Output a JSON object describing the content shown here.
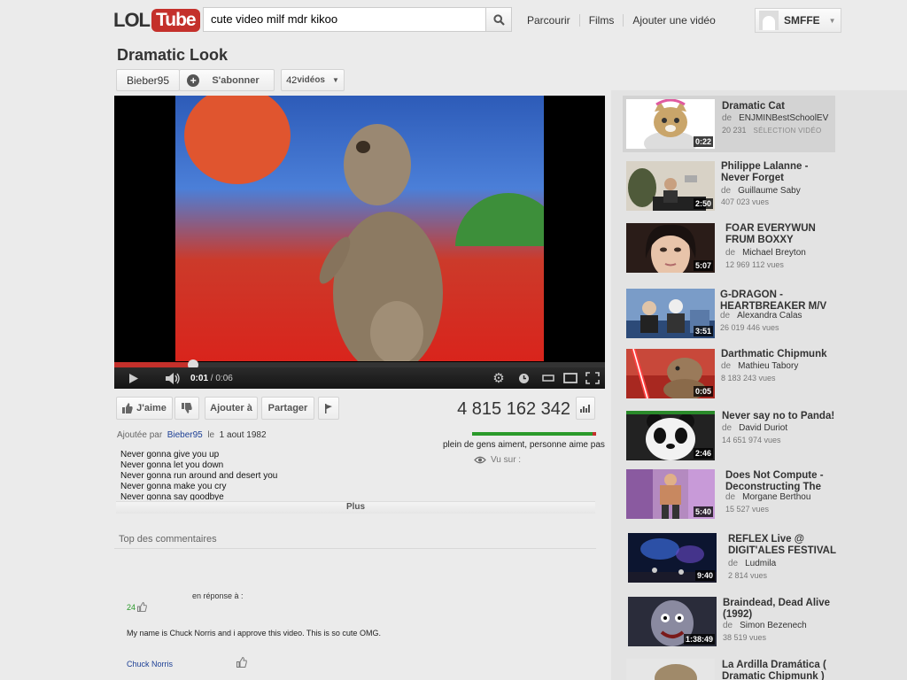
{
  "header": {
    "logo_left": "LOL",
    "logo_right": "Tube",
    "search_value": "cute video milf mdr kikoo",
    "nav": [
      "Parcourir",
      "Films",
      "Ajouter une vidéo"
    ],
    "username": "SMFFE"
  },
  "video": {
    "title": "Dramatic Look",
    "channel": "Bieber95",
    "subscribe_label": "S'abonner",
    "videos_count": "42",
    "videos_label": "vidéos",
    "time_current": "0:01",
    "time_total": "/ 0:06",
    "progress": 0.16
  },
  "actions": {
    "like_label": "J'aime",
    "add_label": "Ajouter à",
    "share_label": "Partager",
    "view_count": "4 815 162 342",
    "like_ratio": 0.97,
    "like_text": "plein de gens aiment, personne aime pas",
    "seen_on_label": "Vu sur :"
  },
  "meta": {
    "added_by_prefix": "Ajoutée par",
    "added_by_user": "Bieber95",
    "added_on_word": "le",
    "added_date": "1 aout 1982",
    "description": [
      "Never gonna give you up",
      "Never gonna let you down",
      "Never gonna run around and desert you",
      "Never gonna make you cry",
      "Never gonna say goodbye"
    ],
    "more_label": "Plus"
  },
  "comments": {
    "heading": "Top des commentaires",
    "reply_to": "en réponse à :",
    "votes": "24",
    "text": "My name is Chuck Norris and i approve this video. This is so cute OMG.",
    "author": "Chuck Norris"
  },
  "sidebar": {
    "by_prefix": "de",
    "views_suffix": "vues",
    "items": [
      {
        "title": "Dramatic Cat",
        "author": "ENJMINBestSchoolEV",
        "views": "20 231",
        "badge": "SÉLECTION VIDÉO",
        "duration": "0:22",
        "thumb_color": "#d9c9a8"
      },
      {
        "title": "Philippe Lalanne - Never Forget",
        "author": "Guillaume Saby",
        "views": "407 023 vues",
        "duration": "2:50",
        "thumb_color": "#c9c2b4"
      },
      {
        "title": "FOAR EVERYWUN FRUM BOXXY",
        "author": "Michael Breyton",
        "views": "12 969 112 vues",
        "duration": "5:07",
        "thumb_color": "#6b4a3a"
      },
      {
        "title": "G-DRAGON - HEARTBREAKER M/V",
        "author": "Alexandra Calas",
        "views": "26 019 446 vues",
        "duration": "3:51",
        "thumb_color": "#6f8fb8"
      },
      {
        "title": "Darthmatic Chipmunk",
        "author": "Mathieu Tabory",
        "views": "8 183 243 vues",
        "duration": "0:05",
        "thumb_color": "#b83228"
      },
      {
        "title": "Never say no to Panda!",
        "author": "David Duriot",
        "views": "14 651 974 vues",
        "duration": "2:46",
        "thumb_color": "#2e2e2e"
      },
      {
        "title": "Does Not Compute - Deconstructing The",
        "author": "Morgane Berthou",
        "views": "15 527 vues",
        "duration": "5:40",
        "thumb_color": "#9a6aa8"
      },
      {
        "title": "REFLEX Live @ DIGIT'ALES FESTIVAL",
        "author": "Ludmila",
        "views": "2 814 vues",
        "duration": "9:40",
        "thumb_color": "#1a2a5a"
      },
      {
        "title": "Braindead, Dead Alive (1992)",
        "author": "Simon Bezenech",
        "views": "38 519 vues",
        "duration": "1:38:49",
        "thumb_color": "#3a3a4a"
      },
      {
        "title": "La Ardilla Dramática ( Dramatic Chipmunk )",
        "author": "",
        "views": "",
        "duration": "",
        "thumb_color": "#b8a88a"
      }
    ]
  },
  "colors": {
    "brand_red": "#c4302b",
    "like_green": "#2a9a2a",
    "link_blue": "#1c3f95",
    "page_bg": "#ebebeb",
    "sidebar_bg": "#e3e3e3"
  }
}
